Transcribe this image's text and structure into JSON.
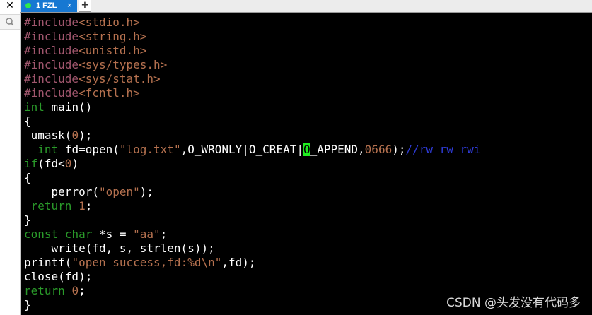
{
  "sidebar": {
    "close_glyph": "✕",
    "search_icon": "search-icon"
  },
  "tabs": {
    "active_label": "1 FZL",
    "close_glyph": "×",
    "add_glyph": "+"
  },
  "code": {
    "l1": {
      "pp": "#include",
      "st": "<stdio.h>"
    },
    "l2": {
      "pp": "#include",
      "st": "<string.h>"
    },
    "l3": {
      "pp": "#include",
      "st": "<unistd.h>"
    },
    "l4": {
      "pp": "#include",
      "st": "<sys/types.h>"
    },
    "l5": {
      "pp": "#include",
      "st": "<sys/stat.h>"
    },
    "l6": {
      "pp": "#include",
      "st": "<fcntl.h>"
    },
    "l7": {
      "kw": "int",
      "rest": " main()"
    },
    "l8": {
      "text": "{"
    },
    "l9": {
      "a": " umask(",
      "n": "0",
      "b": ");"
    },
    "l10": {
      "indent": "  ",
      "kw": "int",
      "a": " fd=open(",
      "st": "\"log.txt\"",
      "b": ",O_WRONLY|O_CREAT|",
      "cur": "O",
      "c": "_APPEND,",
      "n": "0666",
      "d": ");",
      "cm": "//rw rw rwi"
    },
    "l11": {
      "kw": "if",
      "a": "(fd<",
      "n": "0",
      "b": ")"
    },
    "l12": {
      "text": "{"
    },
    "l13": {
      "a": "    perror(",
      "st": "\"open\"",
      "b": ");"
    },
    "l14": {
      "indent": " ",
      "kw": "return",
      "sp": " ",
      "n": "1",
      "b": ";"
    },
    "l15": {
      "text": "}"
    },
    "l16": {
      "kw1": "const",
      "sp": " ",
      "kw2": "char",
      "a": " *s = ",
      "st": "\"aa\"",
      "b": ";"
    },
    "l17": {
      "text": "    write(fd, s, strlen(s));"
    },
    "l18": {
      "a": "printf(",
      "st": "\"open success,fd:%d\\n\"",
      "b": ",fd);"
    },
    "l19": {
      "text": "close(fd);"
    },
    "l20": {
      "kw": "return",
      "sp": " ",
      "n": "0",
      "b": ";"
    },
    "l21": {
      "text": "}"
    }
  },
  "colors": {
    "preprocessor": "#a0566d",
    "keyword": "#2a9a2a",
    "string": "#b5714f",
    "comment": "#2e3bd6",
    "cursor": "#1fee1f",
    "tab_active": "#1778d2"
  },
  "watermark": "CSDN @头发没有代码多"
}
